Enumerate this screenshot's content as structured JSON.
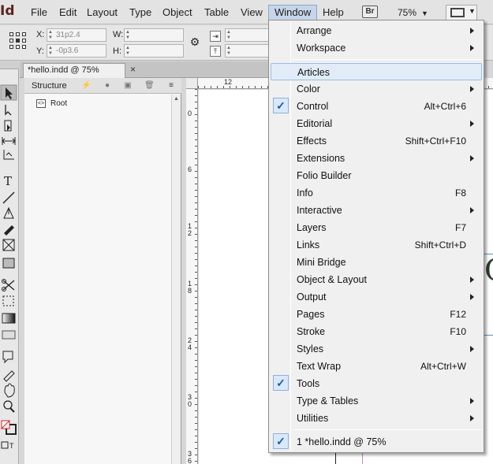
{
  "app": {
    "logo": "Id"
  },
  "menubar": {
    "items": [
      "File",
      "Edit",
      "Layout",
      "Type",
      "Object",
      "Table",
      "View",
      "Window",
      "Help"
    ],
    "bridge_badge": "Br",
    "zoom": "75%"
  },
  "control": {
    "x_label": "X:",
    "x_value": "31p2.4",
    "y_label": "Y:",
    "y_value": "-0p3.6",
    "w_label": "W:",
    "w_value": "",
    "h_label": "H:",
    "h_value": ""
  },
  "document": {
    "tab_title": "*hello.indd @ 75%",
    "close_glyph": "×"
  },
  "structure_panel": {
    "title": "Structure",
    "root_label": "Root",
    "root_icon": "<>"
  },
  "rulers": {
    "top": [
      "12"
    ],
    "left": [
      "0",
      "6",
      "1\n2",
      "1\n8",
      "2\n4",
      "3\n0",
      "3\n6"
    ]
  },
  "canvas_text": "CI",
  "window_menu": {
    "items": [
      {
        "label": "Arrange",
        "submenu": true
      },
      {
        "label": "Workspace",
        "submenu": true
      },
      {
        "separator": true
      },
      {
        "label": "Articles",
        "highlighted": true
      },
      {
        "label": "Color",
        "submenu": true
      },
      {
        "label": "Control",
        "checked": true,
        "shortcut": "Alt+Ctrl+6"
      },
      {
        "label": "Editorial",
        "submenu": true
      },
      {
        "label": "Effects",
        "shortcut": "Shift+Ctrl+F10"
      },
      {
        "label": "Extensions",
        "submenu": true
      },
      {
        "label": "Folio Builder"
      },
      {
        "label": "Info",
        "shortcut": "F8"
      },
      {
        "label": "Interactive",
        "submenu": true
      },
      {
        "label": "Layers",
        "shortcut": "F7"
      },
      {
        "label": "Links",
        "shortcut": "Shift+Ctrl+D"
      },
      {
        "label": "Mini Bridge"
      },
      {
        "label": "Object & Layout",
        "submenu": true
      },
      {
        "label": "Output",
        "submenu": true
      },
      {
        "label": "Pages",
        "shortcut": "F12"
      },
      {
        "label": "Stroke",
        "shortcut": "F10"
      },
      {
        "label": "Styles",
        "submenu": true
      },
      {
        "label": "Text Wrap",
        "shortcut": "Alt+Ctrl+W"
      },
      {
        "label": "Tools",
        "checked": true
      },
      {
        "label": "Type & Tables",
        "submenu": true
      },
      {
        "label": "Utilities",
        "submenu": true
      },
      {
        "separator": true
      },
      {
        "label": "1 *hello.indd @ 75%",
        "checked": true
      }
    ]
  },
  "colors": {
    "accent": "#1a5aa8",
    "highlight": "#e1ecf8",
    "logo": "#5a2323",
    "guide": "#c58ccc"
  }
}
